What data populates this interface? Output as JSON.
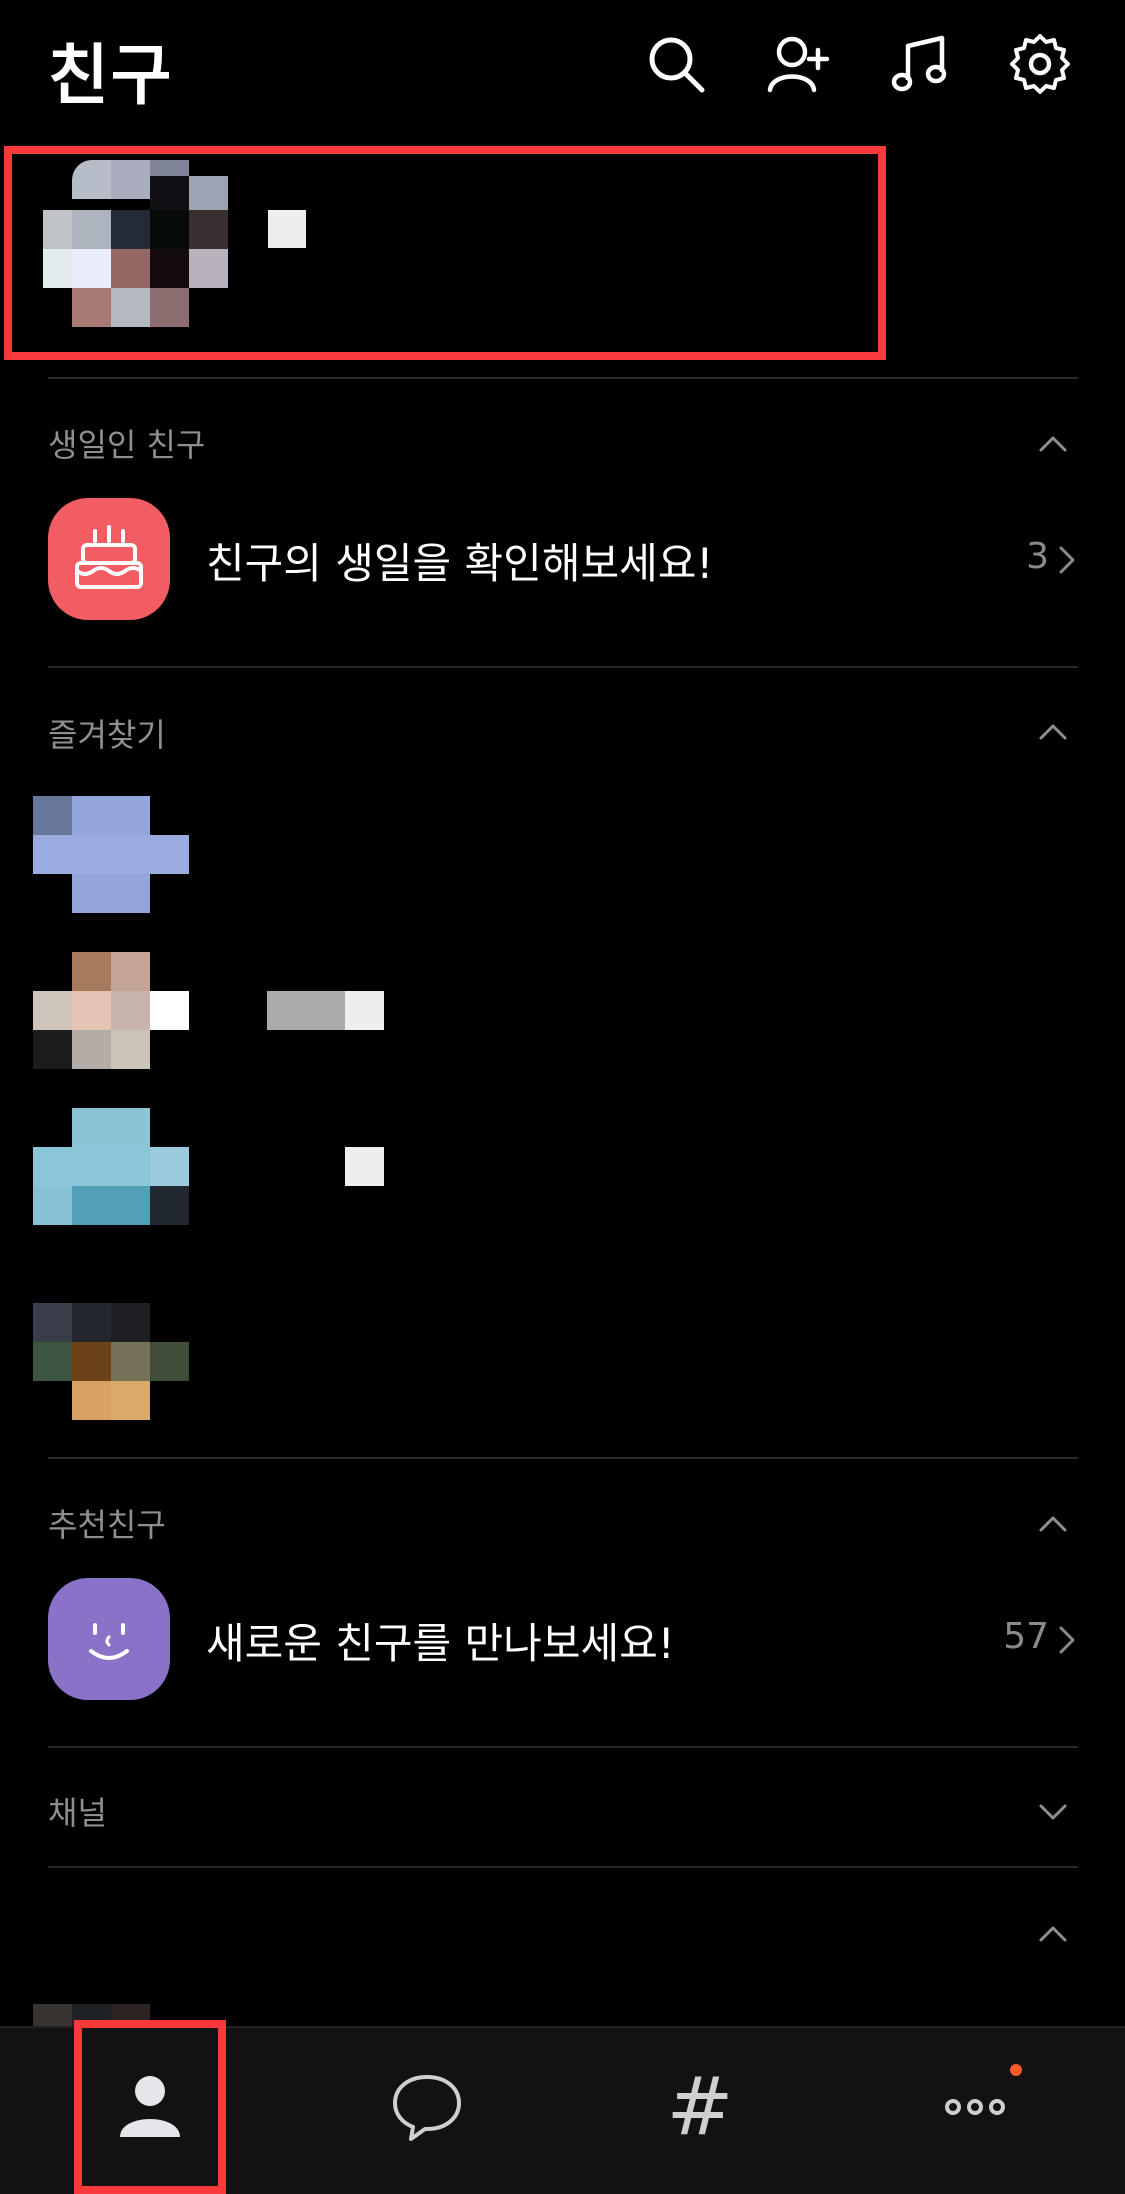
{
  "header": {
    "title": "친구",
    "icons": [
      "search-icon",
      "add-friend-icon",
      "music-icon",
      "settings-icon"
    ]
  },
  "birthday": {
    "section_title": "생일인 친구",
    "row_text": "친구의 생일을 확인해보세요!",
    "count": "3",
    "icon": "cake-icon",
    "icon_color": "#f25c63"
  },
  "favorites": {
    "section_title": "즐겨찾기"
  },
  "recommended": {
    "section_title": "추천친구",
    "row_text": "새로운 친구를 만나보세요!",
    "count": "57",
    "icon": "smile-icon",
    "icon_color": "#8a72c9"
  },
  "channel": {
    "section_title": "채널"
  },
  "bottom_nav": {
    "items": [
      "friends-icon",
      "chat-icon",
      "hashtag-icon",
      "more-icon"
    ],
    "hashtag_label": "#"
  },
  "colors": {
    "highlight": "#fa3a3a",
    "background": "#000000",
    "notification": "#ff5a2a"
  }
}
